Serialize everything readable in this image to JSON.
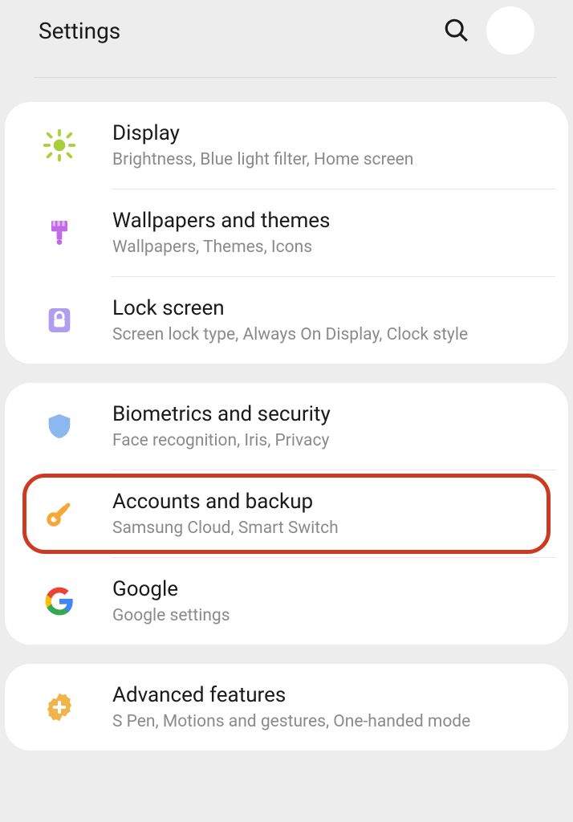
{
  "header": {
    "title": "Settings"
  },
  "groups": [
    {
      "items": [
        {
          "id": "display",
          "title": "Display",
          "subtitle": "Brightness, Blue light filter, Home screen"
        },
        {
          "id": "wallpapers",
          "title": "Wallpapers and themes",
          "subtitle": "Wallpapers, Themes, Icons"
        },
        {
          "id": "lockscreen",
          "title": "Lock screen",
          "subtitle": "Screen lock type, Always On Display, Clock style"
        }
      ]
    },
    {
      "items": [
        {
          "id": "biometrics",
          "title": "Biometrics and security",
          "subtitle": "Face recognition, Iris, Privacy"
        },
        {
          "id": "accounts",
          "title": "Accounts and backup",
          "subtitle": "Samsung Cloud, Smart Switch"
        },
        {
          "id": "google",
          "title": "Google",
          "subtitle": "Google settings"
        }
      ]
    },
    {
      "items": [
        {
          "id": "advanced",
          "title": "Advanced features",
          "subtitle": "S Pen, Motions and gestures, One-handed mode"
        }
      ]
    }
  ]
}
